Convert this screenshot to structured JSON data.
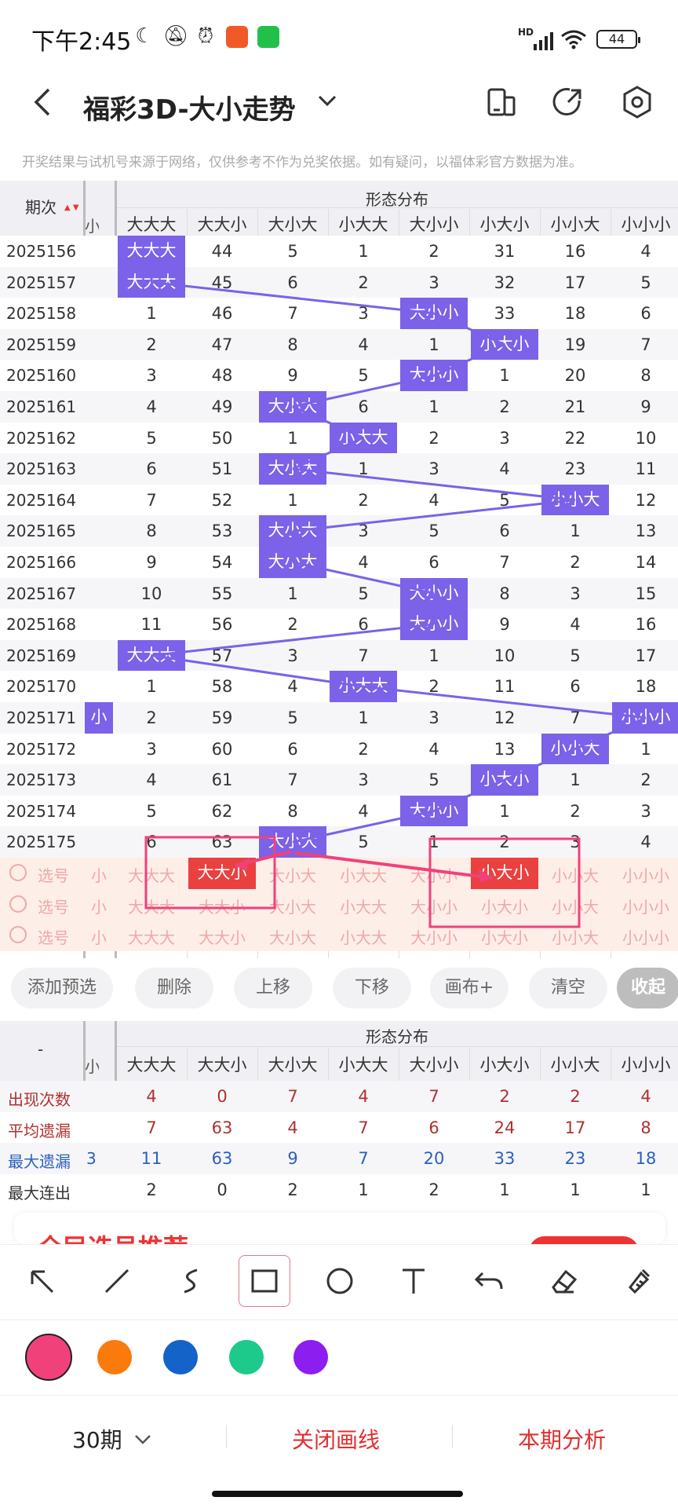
{
  "status_bar": {
    "time": "下午2:45",
    "network": "HD",
    "battery": "44"
  },
  "header": {
    "title": "福彩3D-大小走势",
    "notice": "开奖结果与试机号来源于网络，仅供参考不作为兑奖依据。如有疑问，以福体彩官方数据为准。"
  },
  "table": {
    "period_header": "期次",
    "group_header": "形态分布",
    "partial_col": "小",
    "columns": [
      "大大大",
      "大大小",
      "大小大",
      "小大大",
      "大小小",
      "小大小",
      "小小大",
      "小小小"
    ],
    "rows": [
      {
        "p": "2025156",
        "v": [
          "大大大",
          "44",
          "5",
          "1",
          "2",
          "31",
          "16",
          "4"
        ],
        "hit": 0
      },
      {
        "p": "2025157",
        "v": [
          "大大大",
          "45",
          "6",
          "2",
          "3",
          "32",
          "17",
          "5"
        ],
        "hit": 0
      },
      {
        "p": "2025158",
        "v": [
          "1",
          "46",
          "7",
          "3",
          "大小小",
          "33",
          "18",
          "6"
        ],
        "hit": 4
      },
      {
        "p": "2025159",
        "v": [
          "2",
          "47",
          "8",
          "4",
          "1",
          "小大小",
          "19",
          "7"
        ],
        "hit": 5
      },
      {
        "p": "2025160",
        "v": [
          "3",
          "48",
          "9",
          "5",
          "大小小",
          "1",
          "20",
          "8"
        ],
        "hit": 4
      },
      {
        "p": "2025161",
        "v": [
          "4",
          "49",
          "大小大",
          "6",
          "1",
          "2",
          "21",
          "9"
        ],
        "hit": 2
      },
      {
        "p": "2025162",
        "v": [
          "5",
          "50",
          "1",
          "小大大",
          "2",
          "3",
          "22",
          "10"
        ],
        "hit": 3
      },
      {
        "p": "2025163",
        "v": [
          "6",
          "51",
          "大小大",
          "1",
          "3",
          "4",
          "23",
          "11"
        ],
        "hit": 2
      },
      {
        "p": "2025164",
        "v": [
          "7",
          "52",
          "1",
          "2",
          "4",
          "5",
          "小小大",
          "12"
        ],
        "hit": 6
      },
      {
        "p": "2025165",
        "v": [
          "8",
          "53",
          "大小大",
          "3",
          "5",
          "6",
          "1",
          "13"
        ],
        "hit": 2
      },
      {
        "p": "2025166",
        "v": [
          "9",
          "54",
          "大小大",
          "4",
          "6",
          "7",
          "2",
          "14"
        ],
        "hit": 2
      },
      {
        "p": "2025167",
        "v": [
          "10",
          "55",
          "1",
          "5",
          "大小小",
          "8",
          "3",
          "15"
        ],
        "hit": 4
      },
      {
        "p": "2025168",
        "v": [
          "11",
          "56",
          "2",
          "6",
          "大小小",
          "9",
          "4",
          "16"
        ],
        "hit": 4
      },
      {
        "p": "2025169",
        "v": [
          "大大大",
          "57",
          "3",
          "7",
          "1",
          "10",
          "5",
          "17"
        ],
        "hit": 0
      },
      {
        "p": "2025170",
        "v": [
          "1",
          "58",
          "4",
          "小大大",
          "2",
          "11",
          "6",
          "18"
        ],
        "hit": 3
      },
      {
        "p": "2025171",
        "v": [
          "2",
          "59",
          "5",
          "1",
          "3",
          "12",
          "7",
          "小小小"
        ],
        "hit": 7
      },
      {
        "p": "2025172",
        "v": [
          "3",
          "60",
          "6",
          "2",
          "4",
          "13",
          "小小大",
          "1"
        ],
        "hit": 6
      },
      {
        "p": "2025173",
        "v": [
          "4",
          "61",
          "7",
          "3",
          "5",
          "小大小",
          "1",
          "2"
        ],
        "hit": 5
      },
      {
        "p": "2025174",
        "v": [
          "5",
          "62",
          "8",
          "4",
          "大小小",
          "1",
          "2",
          "3"
        ],
        "hit": 4
      },
      {
        "p": "2025175",
        "v": [
          "6",
          "63",
          "大小大",
          "5",
          "1",
          "2",
          "3",
          "4"
        ],
        "hit": 2
      }
    ],
    "pick_label": "选号",
    "pick_rows": 3
  },
  "actions": [
    "添加预选",
    "删除",
    "上移",
    "下移",
    "画布+",
    "清空",
    "收起"
  ],
  "stats": {
    "dash": "-",
    "group_header": "形态分布",
    "rows": [
      {
        "label": "出现次数",
        "color": "#b03030",
        "v": [
          "4",
          "0",
          "7",
          "4",
          "7",
          "2",
          "2",
          "4"
        ]
      },
      {
        "label": "平均遗漏",
        "color": "#b03030",
        "v": [
          "7",
          "63",
          "4",
          "7",
          "6",
          "24",
          "17",
          "8"
        ]
      },
      {
        "label": "最大遗漏",
        "color": "#2a5fc0",
        "v": [
          "11",
          "63",
          "9",
          "7",
          "20",
          "33",
          "23",
          "18"
        ]
      },
      {
        "label": "最大连出",
        "color": "#333333",
        "v": [
          "2",
          "0",
          "2",
          "1",
          "2",
          "1",
          "1",
          "1"
        ]
      }
    ],
    "partial_values": [
      "",
      "",
      "3",
      ""
    ]
  },
  "promo": "全民选号推荐",
  "drawing_tools": [
    "arrow-tool",
    "line-tool",
    "curve-tool",
    "rectangle-tool",
    "circle-tool",
    "text-tool",
    "undo-tool",
    "eraser-tool",
    "clear-tool"
  ],
  "colors": [
    "#f0417a",
    "#fb7a0c",
    "#1463c9",
    "#1ec98c",
    "#8c1ef0"
  ],
  "bottom": {
    "periods": "30期",
    "close_lines": "关闭画线",
    "analysis": "本期分析"
  }
}
